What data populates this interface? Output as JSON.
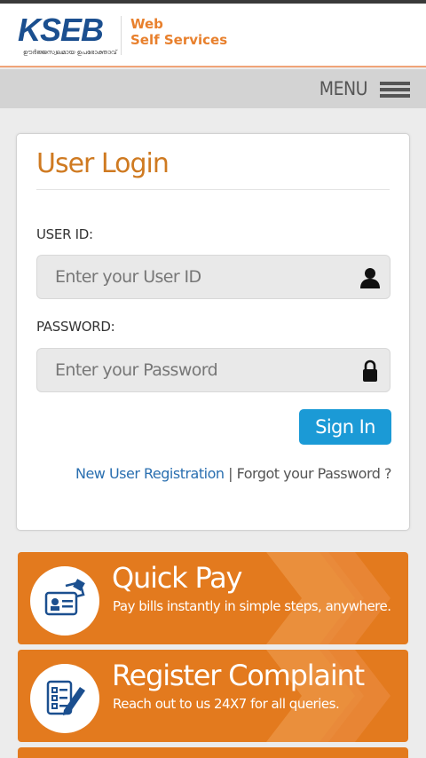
{
  "header": {
    "logo_text": "KSEB",
    "logo_tagline": "ഊർജ്ജസ്വലമായ ഉപഭോക്താവ്",
    "brand_line1": "Web",
    "brand_line2": "Self Services"
  },
  "menu": {
    "label": "MENU"
  },
  "login": {
    "title": "User Login",
    "user_label": "USER ID:",
    "user_placeholder": "Enter your User ID",
    "user_value": "",
    "password_label": "PASSWORD:",
    "password_placeholder": "Enter your Password",
    "password_value": "",
    "signin_label": "Sign In",
    "register_link": "New User Registration",
    "separator": "|",
    "forgot_link": "Forgot your Password ?"
  },
  "tiles": [
    {
      "title": "Quick Pay",
      "subtitle": "Pay bills instantly in simple steps, anywhere.",
      "icon": "card-payment-icon"
    },
    {
      "title": "Register Complaint",
      "subtitle": "Reach out to us 24X7 for all queries.",
      "icon": "checklist-pen-icon"
    }
  ],
  "colors": {
    "brand_orange": "#e37a1e",
    "title_orange": "#cf7a21",
    "logo_blue": "#1b4f8f",
    "signin_blue": "#1b9ad6",
    "link_blue": "#2a6fb0"
  }
}
